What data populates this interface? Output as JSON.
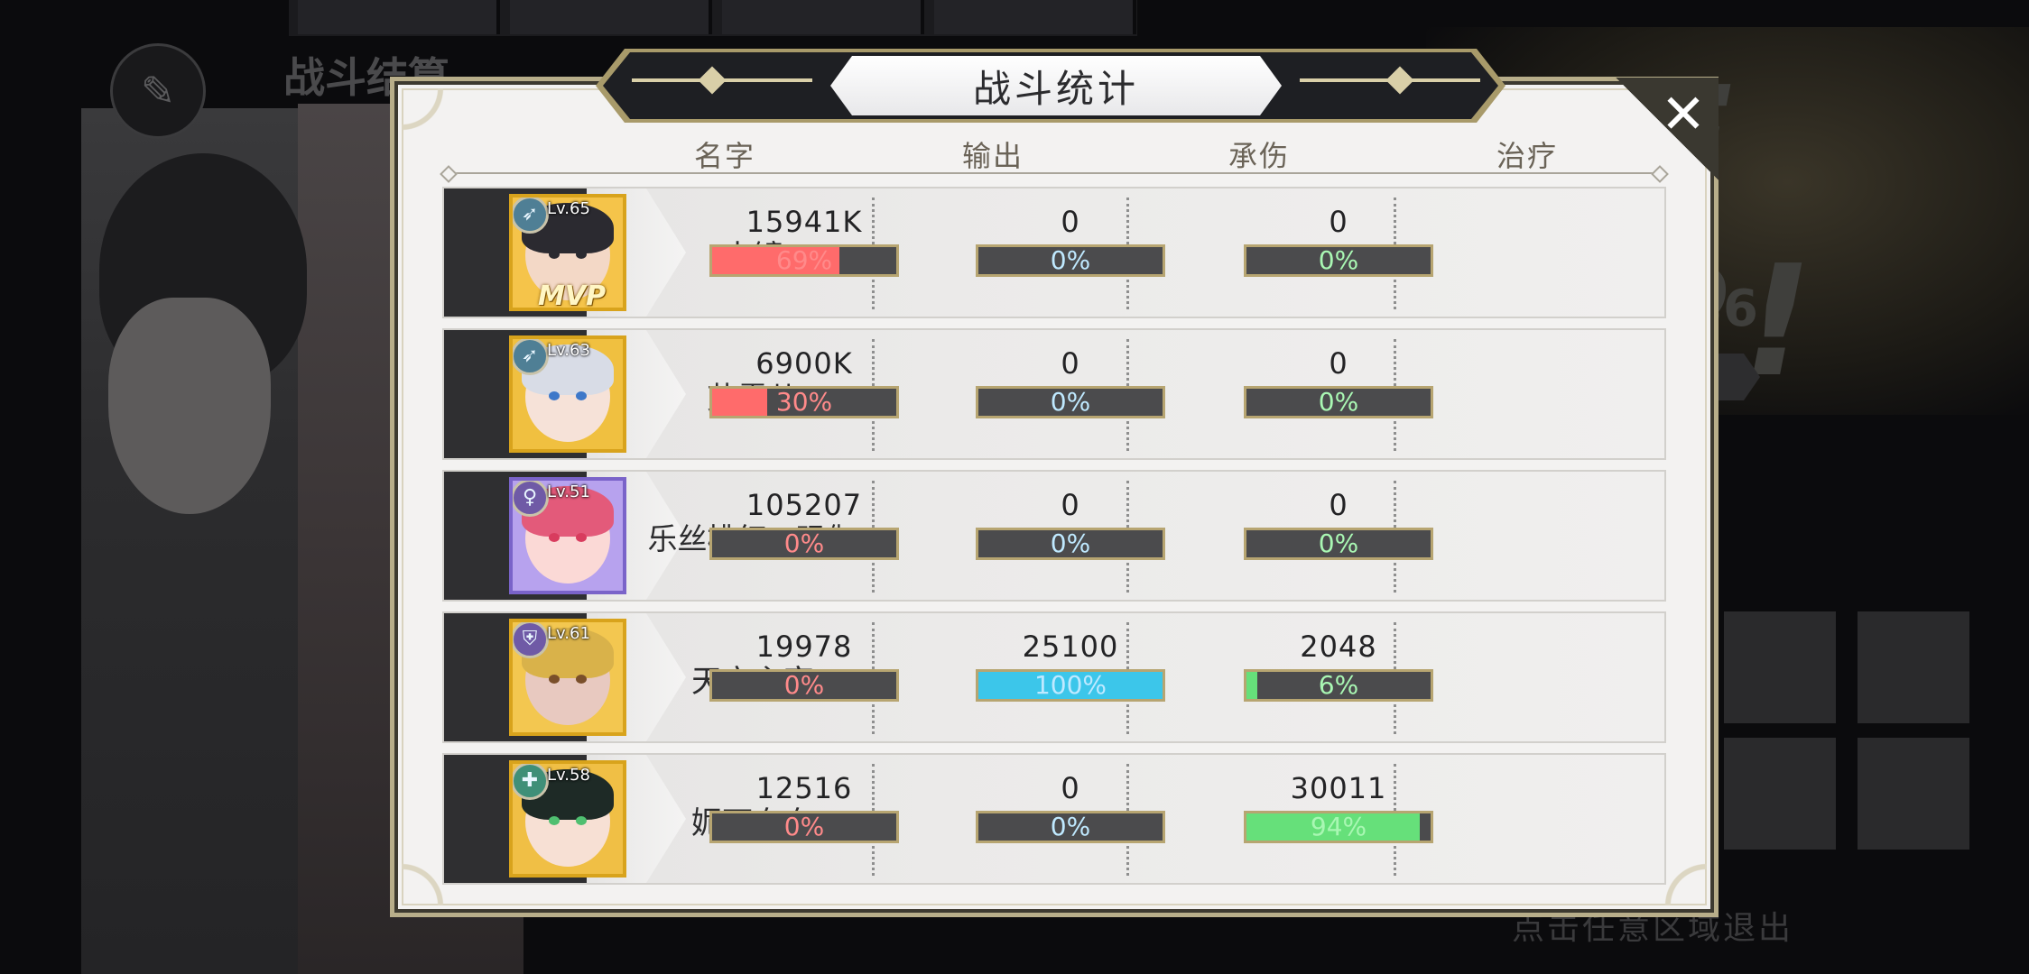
{
  "background": {
    "screen_title": "战斗结算",
    "exit_hint": "点击任意区域退出"
  },
  "dialog": {
    "title": "战斗统计",
    "close_label": "✕",
    "headers": {
      "name": "名字",
      "output": "输出",
      "damage_taken": "承伤",
      "healing": "治疗"
    }
  },
  "colors": {
    "output_bar": "#ff6b6b",
    "taken_bar": "#3cc6ea",
    "heal_bar": "#66e07a",
    "bar_text_output": "#ff8a8a",
    "bar_text_taken": "#bfe9ff",
    "bar_text_heal": "#a9f7b3"
  },
  "rows": [
    {
      "name": "水镜",
      "level": "Lv.65",
      "class_icon": "archer-icon",
      "mvp": "MVP",
      "output": {
        "value": "15941K",
        "percent": 69,
        "label": "69%"
      },
      "taken": {
        "value": "0",
        "percent": 0,
        "label": "0%"
      },
      "heal": {
        "value": "0",
        "percent": 0,
        "label": "0%"
      }
    },
    {
      "name": "艾露儿",
      "level": "Lv.63",
      "class_icon": "archer-icon",
      "output": {
        "value": "6900K",
        "percent": 30,
        "label": "30%"
      },
      "taken": {
        "value": "0",
        "percent": 0,
        "label": "0%"
      },
      "heal": {
        "value": "0",
        "percent": 0,
        "label": "0%"
      }
    },
    {
      "name": "乐丝桃红・玛伽",
      "level": "Lv.51",
      "class_icon": "mage-icon",
      "output": {
        "value": "105207",
        "percent": 0,
        "label": "0%"
      },
      "taken": {
        "value": "0",
        "percent": 0,
        "label": "0%"
      },
      "heal": {
        "value": "0",
        "percent": 0,
        "label": "0%"
      }
    },
    {
      "name": "天空主宰",
      "level": "Lv.61",
      "class_icon": "shield-icon",
      "output": {
        "value": "19978",
        "percent": 0,
        "label": "0%"
      },
      "taken": {
        "value": "25100",
        "percent": 100,
        "label": "100%"
      },
      "heal": {
        "value": "2048",
        "percent": 6,
        "label": "6%"
      }
    },
    {
      "name": "妮可奈奈",
      "level": "Lv.58",
      "class_icon": "healer-icon",
      "output": {
        "value": "12516",
        "percent": 0,
        "label": "0%"
      },
      "taken": {
        "value": "0",
        "percent": 0,
        "label": "0%"
      },
      "heal": {
        "value": "30011",
        "percent": 94,
        "label": "94%"
      }
    }
  ]
}
